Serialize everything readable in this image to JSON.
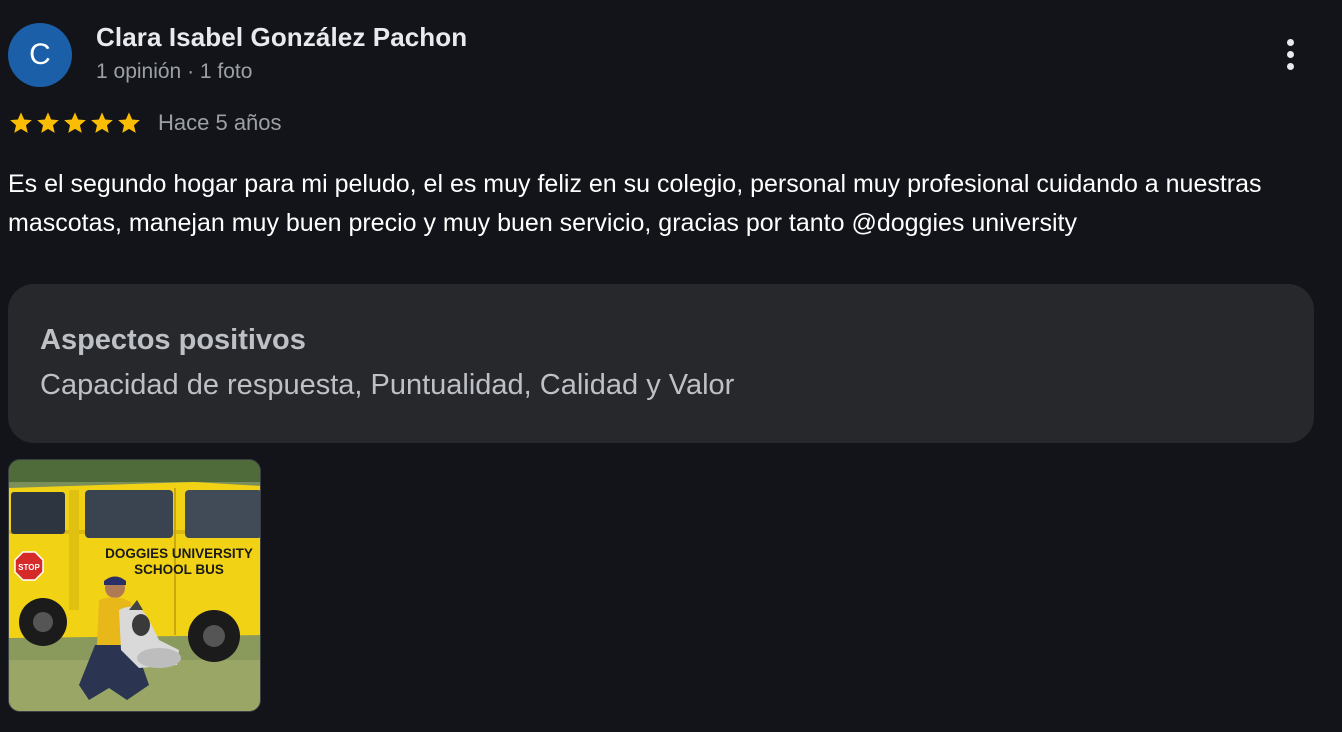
{
  "author": {
    "initial": "C",
    "name": "Clara Isabel González Pachon",
    "meta": "1 opinión · 1 foto",
    "avatar_color": "#1a5fa8"
  },
  "rating": {
    "stars": 5,
    "max": 5,
    "star_color": "#fbbc04",
    "time_ago": "Hace 5 años"
  },
  "review": {
    "text": "Es el segundo hogar para mi peludo, el es muy feliz en su colegio, personal muy profesional cuidando a nuestras mascotas, manejan muy buen precio y muy buen servicio, gracias por tanto @doggies university"
  },
  "aspects": {
    "title": "Aspectos positivos",
    "values": "Capacidad de respuesta, Puntualidad, Calidad y Valor"
  },
  "photo": {
    "bus_line1": "DOGGIES UNIVERSITY",
    "bus_line2": "SCHOOL BUS",
    "stop_sign": "STOP"
  },
  "icons": {
    "menu": "more-vert-icon",
    "star": "star-icon"
  }
}
